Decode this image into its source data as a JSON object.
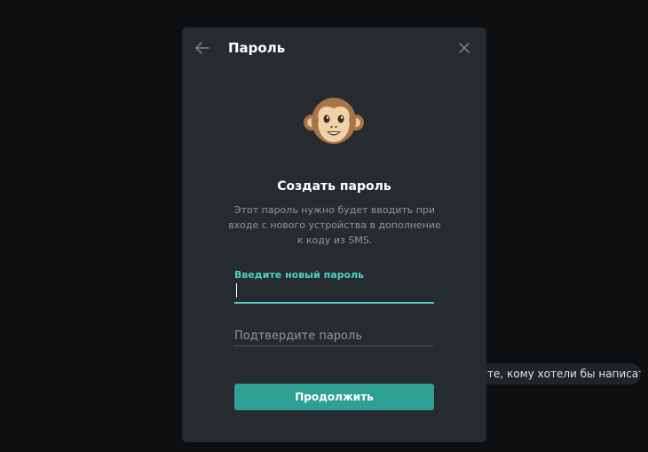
{
  "background": {
    "chip_text": "те, кому хотели бы написать"
  },
  "dialog": {
    "title": "Пароль",
    "back_icon": "arrow-left-icon",
    "close_icon": "close-icon",
    "avatar_icon": "monkey-face-icon",
    "heading": "Создать пароль",
    "description": "Этот пароль нужно будет вводить при входе с нового устройства в дополнение к коду из SMS.",
    "new_password": {
      "label": "Введите новый пароль",
      "value": ""
    },
    "confirm_password": {
      "placeholder": "Подтвердите пароль",
      "value": ""
    },
    "continue_label": "Продолжить"
  },
  "colors": {
    "accent": "#4fd1c0",
    "button": "#2fa093",
    "dialog_bg": "#252b2f",
    "page_bg": "#0e0f11"
  }
}
